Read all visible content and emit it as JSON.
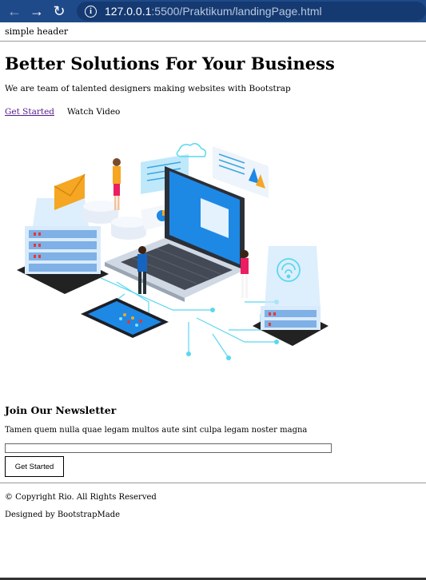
{
  "browser": {
    "url_host": "127.0.0.1",
    "url_rest": ":5500/Praktikum/landingPage.html"
  },
  "header": {
    "text": "simple header"
  },
  "hero": {
    "title": "Better Solutions For Your Business",
    "subtitle": "We are team of talented designers making websites with Bootstrap",
    "get_started": "Get Started",
    "watch_video": "Watch Video"
  },
  "newsletter": {
    "title": "Join Our Newsletter",
    "text": "Tamen quem nulla quae legam multos aute sint culpa legam noster magna",
    "input_value": "",
    "button_label": "Get Started"
  },
  "footer": {
    "copyright": "© Copyright Rio. All Rights Reserved",
    "designed_by": "Designed by BootstrapMade"
  },
  "colors": {
    "browser_bar": "#1f4a8a",
    "link_visited": "#551a8b",
    "illustration_blue": "#1e88e5"
  }
}
